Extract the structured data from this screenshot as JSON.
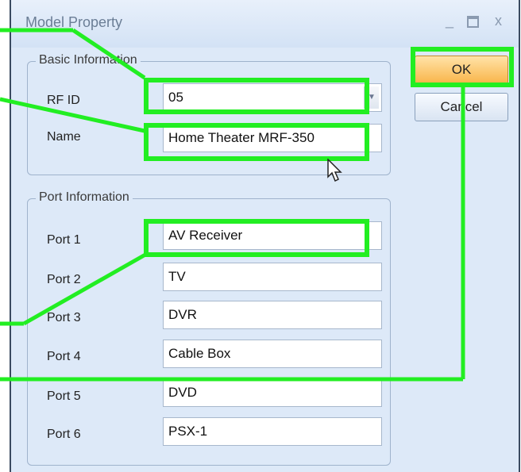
{
  "window": {
    "title": "Model Property"
  },
  "title_buttons": {
    "minimize": "_",
    "close": "x"
  },
  "basic_info": {
    "legend": "Basic Information",
    "rf_id_label": "RF ID",
    "rf_id_value": "05",
    "name_label": "Name",
    "name_value": "Home Theater MRF-350"
  },
  "port_info": {
    "legend": "Port Information",
    "ports": [
      {
        "label": "Port 1",
        "value": "AV Receiver"
      },
      {
        "label": "Port 2",
        "value": "TV"
      },
      {
        "label": "Port 3",
        "value": "DVR"
      },
      {
        "label": "Port 4",
        "value": "Cable Box"
      },
      {
        "label": "Port 5",
        "value": "DVD"
      },
      {
        "label": "Port 6",
        "value": "PSX-1"
      }
    ]
  },
  "buttons": {
    "ok": "OK",
    "cancel": "Cancel"
  },
  "colors": {
    "highlight": "#22ee22",
    "ok_button": "#f9b54a",
    "dialog_bg": "#dde9f8"
  }
}
